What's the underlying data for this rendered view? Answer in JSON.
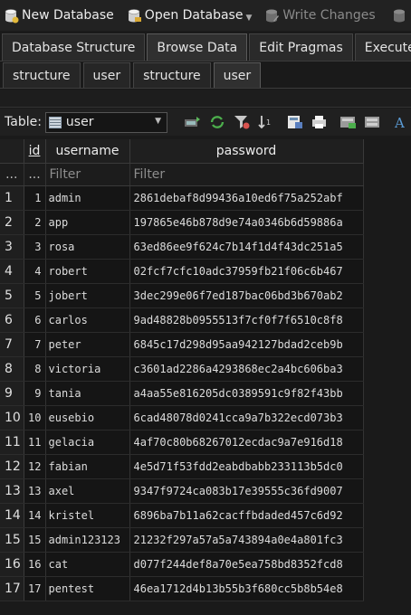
{
  "toolbar": {
    "new_database": "New Database",
    "open_database": "Open Database",
    "write_changes": "Write Changes",
    "revert_changes": "R"
  },
  "main_tabs": [
    {
      "label": "Database Structure",
      "active": false
    },
    {
      "label": "Browse Data",
      "active": true
    },
    {
      "label": "Edit Pragmas",
      "active": false
    },
    {
      "label": "Execute SQL",
      "active": false
    }
  ],
  "sub_tabs": [
    {
      "label": "structure",
      "active": false
    },
    {
      "label": "user",
      "active": false
    },
    {
      "label": "structure",
      "active": false
    },
    {
      "label": "user",
      "active": true
    }
  ],
  "table_bar": {
    "label": "Table:",
    "selected_table": "user"
  },
  "grid": {
    "columns": [
      "id",
      "username",
      "password"
    ],
    "filter_rownum": "...",
    "filter_placeholder": "Filter",
    "rows": [
      {
        "n": "1",
        "id": "1",
        "username": "admin",
        "password": "2861debaf8d99436a10ed6f75a252abf"
      },
      {
        "n": "2",
        "id": "2",
        "username": "app",
        "password": "197865e46b878d9e74a0346b6d59886a"
      },
      {
        "n": "3",
        "id": "3",
        "username": "rosa",
        "password": "63ed86ee9f624c7b14f1d4f43dc251a5"
      },
      {
        "n": "4",
        "id": "4",
        "username": "robert",
        "password": "02fcf7cfc10adc37959fb21f06c6b467"
      },
      {
        "n": "5",
        "id": "5",
        "username": "jobert",
        "password": "3dec299e06f7ed187bac06bd3b670ab2"
      },
      {
        "n": "6",
        "id": "6",
        "username": "carlos",
        "password": "9ad48828b0955513f7cf0f7f6510c8f8"
      },
      {
        "n": "7",
        "id": "7",
        "username": "peter",
        "password": "6845c17d298d95aa942127bdad2ceb9b"
      },
      {
        "n": "8",
        "id": "8",
        "username": "victoria",
        "password": "c3601ad2286a4293868ec2a4bc606ba3"
      },
      {
        "n": "9",
        "id": "9",
        "username": "tania",
        "password": "a4aa55e816205dc0389591c9f82f43bb"
      },
      {
        "n": "10",
        "id": "10",
        "username": "eusebio",
        "password": "6cad48078d0241cca9a7b322ecd073b3"
      },
      {
        "n": "11",
        "id": "11",
        "username": "gelacia",
        "password": "4af70c80b68267012ecdac9a7e916d18"
      },
      {
        "n": "12",
        "id": "12",
        "username": "fabian",
        "password": "4e5d71f53fdd2eabdbabb233113b5dc0"
      },
      {
        "n": "13",
        "id": "13",
        "username": "axel",
        "password": "9347f9724ca083b17e39555c36fd9007"
      },
      {
        "n": "14",
        "id": "14",
        "username": "kristel",
        "password": "6896ba7b11a62cacffbdaded457c6d92"
      },
      {
        "n": "15",
        "id": "15",
        "username": "admin123123",
        "password": "21232f297a57a5a743894a0e4a801fc3"
      },
      {
        "n": "16",
        "id": "16",
        "username": "cat",
        "password": "d077f244def8a70e5ea758bd8352fcd8"
      },
      {
        "n": "17",
        "id": "17",
        "username": "pentest",
        "password": "46ea1712d4b13b55b3f680cc5b8b54e8"
      }
    ]
  }
}
